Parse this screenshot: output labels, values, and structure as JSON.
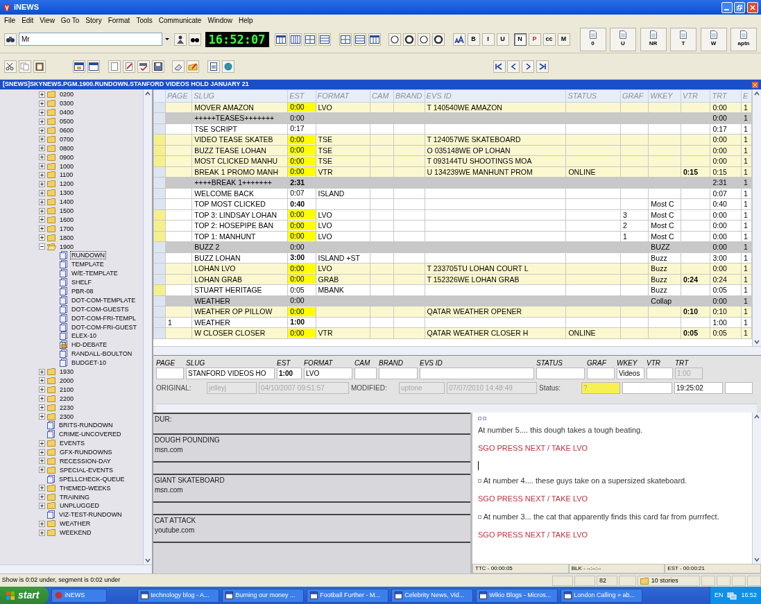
{
  "window": {
    "title": "iNEWS"
  },
  "menu": [
    "File",
    "Edit",
    "View",
    "Go To",
    "Story",
    "Format",
    "Tools",
    "Communicate",
    "Window",
    "Help"
  ],
  "toolbar": {
    "search": {
      "value": "Mr"
    },
    "clock": "16:52:07",
    "format_buttons": [
      {
        "label": "B",
        "pressed": false
      },
      {
        "label": "I",
        "pressed": false
      },
      {
        "label": "U",
        "pressed": false
      },
      {
        "label": "N",
        "pressed": true
      },
      {
        "label": "P",
        "pressed": false
      },
      {
        "label": "cc",
        "pressed": false
      },
      {
        "label": "M",
        "pressed": false
      }
    ],
    "doc_buttons": [
      "0",
      "U",
      "NR",
      "T",
      "W",
      "aptn"
    ]
  },
  "story_title": "[SNEWS]SKYNEWS.PGM.1900.RUNDOWN.STANFORD VIDEOS HOLD JANUARY 21",
  "tree": [
    {
      "label": "0200",
      "kind": "folder",
      "expanded": false,
      "selected": false
    },
    {
      "label": "0300",
      "kind": "folder",
      "expanded": false,
      "selected": false
    },
    {
      "label": "0400",
      "kind": "folder",
      "expanded": false,
      "selected": false
    },
    {
      "label": "0500",
      "kind": "folder",
      "expanded": false,
      "selected": false
    },
    {
      "label": "0600",
      "kind": "folder",
      "expanded": false,
      "selected": false
    },
    {
      "label": "0700",
      "kind": "folder",
      "expanded": false,
      "selected": false
    },
    {
      "label": "0800",
      "kind": "folder",
      "expanded": false,
      "selected": false
    },
    {
      "label": "0900",
      "kind": "folder",
      "expanded": false,
      "selected": false
    },
    {
      "label": "1000",
      "kind": "folder",
      "expanded": false,
      "selected": false
    },
    {
      "label": "1100",
      "kind": "folder",
      "expanded": false,
      "selected": false
    },
    {
      "label": "1200",
      "kind": "folder",
      "expanded": false,
      "selected": false
    },
    {
      "label": "1300",
      "kind": "folder",
      "expanded": false,
      "selected": false
    },
    {
      "label": "1400",
      "kind": "folder",
      "expanded": false,
      "selected": false
    },
    {
      "label": "1500",
      "kind": "folder",
      "expanded": false,
      "selected": false
    },
    {
      "label": "1600",
      "kind": "folder",
      "expanded": false,
      "selected": false
    },
    {
      "label": "1700",
      "kind": "folder",
      "expanded": false,
      "selected": false
    },
    {
      "label": "1800",
      "kind": "folder",
      "expanded": false,
      "selected": false
    },
    {
      "label": "1900",
      "kind": "folder",
      "expanded": true,
      "selected": false,
      "children": [
        {
          "label": "RUNDOWN",
          "kind": "queue",
          "locked": false,
          "selected": true
        },
        {
          "label": "TEMPLATE",
          "kind": "queue",
          "locked": false,
          "selected": false
        },
        {
          "label": "W/E-TEMPLATE",
          "kind": "queue",
          "locked": false,
          "selected": false
        },
        {
          "label": "SHELF",
          "kind": "queue",
          "locked": false,
          "selected": false
        },
        {
          "label": "PBR-08",
          "kind": "queue",
          "locked": false,
          "selected": false
        },
        {
          "label": "DOT-COM-TEMPLATE",
          "kind": "queue",
          "locked": false,
          "selected": false
        },
        {
          "label": "DOT-COM-GUESTS",
          "kind": "queue",
          "locked": false,
          "selected": false
        },
        {
          "label": "DOT-COM-FRI-TEMPL",
          "kind": "queue",
          "locked": false,
          "selected": false
        },
        {
          "label": "DOT-COM-FRI-GUEST",
          "kind": "queue",
          "locked": false,
          "selected": false
        },
        {
          "label": "ELEX-10",
          "kind": "queue",
          "locked": false,
          "selected": false
        },
        {
          "label": "HD-DEBATE",
          "kind": "queue",
          "locked": true,
          "selected": false
        },
        {
          "label": "RANDALL-BOULTON",
          "kind": "queue",
          "locked": false,
          "selected": false
        },
        {
          "label": "BUDGET-10",
          "kind": "queue",
          "locked": false,
          "selected": false
        }
      ]
    },
    {
      "label": "1930",
      "kind": "folder",
      "expanded": false,
      "selected": false
    },
    {
      "label": "2000",
      "kind": "folder",
      "expanded": false,
      "selected": false
    },
    {
      "label": "2100",
      "kind": "folder",
      "expanded": false,
      "selected": false
    },
    {
      "label": "2200",
      "kind": "folder",
      "expanded": false,
      "selected": false
    },
    {
      "label": "2230",
      "kind": "folder",
      "expanded": false,
      "selected": false
    },
    {
      "label": "2300",
      "kind": "folder",
      "expanded": false,
      "selected": false
    },
    {
      "label": "BRITS-RUNDOWN",
      "kind": "queue",
      "locked": false,
      "selected": false
    },
    {
      "label": "CRIME-UNCOVERED",
      "kind": "queue",
      "locked": false,
      "selected": false
    },
    {
      "label": "EVENTS",
      "kind": "folder",
      "expanded": false,
      "selected": false
    },
    {
      "label": "GFX-RUNDOWNS",
      "kind": "folder",
      "expanded": false,
      "selected": false
    },
    {
      "label": "RECESSION-DAY",
      "kind": "folder",
      "expanded": false,
      "selected": false
    },
    {
      "label": "SPECIAL-EVENTS",
      "kind": "folder",
      "expanded": false,
      "selected": false
    },
    {
      "label": "SPELLCHECK-QUEUE",
      "kind": "queue",
      "locked": false,
      "selected": false
    },
    {
      "label": "THEMED-WEEKS",
      "kind": "folder",
      "expanded": false,
      "selected": false
    },
    {
      "label": "TRAINING",
      "kind": "folder",
      "expanded": false,
      "selected": false
    },
    {
      "label": "UNPLUGGED",
      "kind": "folder",
      "expanded": false,
      "selected": false
    },
    {
      "label": "VIZ-TEST-RUNDOWN",
      "kind": "queue",
      "locked": false,
      "selected": false
    },
    {
      "label": "WEATHER",
      "kind": "folder",
      "expanded": false,
      "selected": false
    },
    {
      "label": "WEEKEND",
      "kind": "folder",
      "expanded": false,
      "selected": false
    }
  ],
  "rundown": {
    "columns": [
      "PAGE",
      "SLUG",
      "EST",
      "FORMAT",
      "CAM",
      "BRAND",
      "EVS ID",
      "STATUS",
      "GRAF",
      "WKEY",
      "VTR",
      "TRT",
      "E"
    ],
    "rows": [
      {
        "kind": "story",
        "marked": false,
        "slug": "MOVER AMAZON",
        "est": "0:00",
        "est_flag": true,
        "est_bold": false,
        "format": "LVO",
        "evs_id": "T 140540WE AMAZON",
        "trt": "0:00",
        "col_e": "1"
      },
      {
        "kind": "break",
        "marked": false,
        "slug": "+++++TEASES+++++++",
        "est": "0:00",
        "est_flag": false,
        "est_bold": false,
        "trt": "0:00",
        "col_e": "1"
      },
      {
        "kind": "plain",
        "marked": false,
        "slug": "TSE SCRIPT",
        "est": "0:17",
        "est_flag": false,
        "est_bold": false,
        "trt": "0:17",
        "col_e": "1"
      },
      {
        "kind": "story",
        "marked": true,
        "slug": "VIDEO TEASE SKATEB",
        "est": "0:00",
        "est_flag": true,
        "est_bold": false,
        "format": "TSE",
        "evs_id": "T 124057WE SKATEBOARD",
        "trt": "0:00",
        "col_e": "1"
      },
      {
        "kind": "story",
        "marked": true,
        "slug": "BUZZ TEASE LOHAN",
        "est": "0:00",
        "est_flag": true,
        "est_bold": false,
        "format": "TSE",
        "evs_id": "O 035148WE OP LOHAN",
        "trt": "0:00",
        "col_e": "1"
      },
      {
        "kind": "story",
        "marked": true,
        "slug": "MOST CLICKED MANHU",
        "est": "0:00",
        "est_flag": true,
        "est_bold": false,
        "format": "TSE",
        "evs_id": "T 093144TU SHOOTINGS MOA",
        "trt": "0:00",
        "col_e": "1"
      },
      {
        "kind": "story",
        "marked": false,
        "slug": "BREAK 1 PROMO MANH",
        "est": "0:00",
        "est_flag": true,
        "est_bold": false,
        "format": "VTR",
        "evs_id": "U 134239WE MANHUNT PROM",
        "status": "ONLINE",
        "vtr": "0:15",
        "trt": "0:15",
        "col_e": "1"
      },
      {
        "kind": "break",
        "marked": false,
        "slug": "++++BREAK 1+++++++",
        "est": "2:31",
        "est_flag": false,
        "est_bold": true,
        "trt": "2:31",
        "col_e": "1"
      },
      {
        "kind": "plain",
        "marked": false,
        "slug": "WELCOME BACK",
        "est": "0:07",
        "est_flag": false,
        "est_bold": false,
        "format": "ISLAND",
        "trt": "0:07",
        "col_e": "1"
      },
      {
        "kind": "plain",
        "marked": false,
        "slug": "TOP MOST CLICKED",
        "est": "0:40",
        "est_flag": false,
        "est_bold": true,
        "wkey": "Most C",
        "trt": "0:40",
        "col_e": "1"
      },
      {
        "kind": "plain",
        "marked": true,
        "slug": "TOP 3: LINDSAY LOHAN",
        "est": "0:00",
        "est_flag": true,
        "est_bold": false,
        "format": "LVO",
        "graf": "3",
        "wkey": "Most C",
        "trt": "0:00",
        "col_e": "1"
      },
      {
        "kind": "plain",
        "marked": true,
        "slug": "TOP 2: HOSEPIPE BAN",
        "est": "0:00",
        "est_flag": true,
        "est_bold": false,
        "format": "LVO",
        "graf": "2",
        "wkey": "Most C",
        "trt": "0:00",
        "col_e": "1"
      },
      {
        "kind": "plain",
        "marked": true,
        "slug": "TOP 1: MANHUNT",
        "est": "0:00",
        "est_flag": true,
        "est_bold": false,
        "format": "LVO",
        "graf": "1",
        "wkey": "Most C",
        "trt": "0:00",
        "col_e": "1"
      },
      {
        "kind": "break",
        "marked": false,
        "slug": "BUZZ 2",
        "est": "0:00",
        "est_flag": false,
        "est_bold": false,
        "wkey": "BUZZ",
        "trt": "0:00",
        "col_e": "1"
      },
      {
        "kind": "plain",
        "marked": false,
        "slug": "BUZZ LOHAN",
        "est": "3:00",
        "est_flag": false,
        "est_bold": true,
        "format": "ISLAND +ST",
        "wkey": "Buzz",
        "trt": "3:00",
        "col_e": "1"
      },
      {
        "kind": "story",
        "marked": false,
        "slug": "LOHAN LVO",
        "est": "0:00",
        "est_flag": true,
        "est_bold": false,
        "format": "LVO",
        "evs_id": "T 233705TU LOHAN COURT L",
        "wkey": "Buzz",
        "trt": "0:00",
        "col_e": "1"
      },
      {
        "kind": "story",
        "marked": false,
        "slug": "LOHAN GRAB",
        "est": "0:00",
        "est_flag": true,
        "est_bold": false,
        "format": "GRAB",
        "evs_id": "T 152326WE LOHAN GRAB",
        "wkey": "Buzz",
        "vtr": "0:24",
        "trt": "0:24",
        "col_e": "1"
      },
      {
        "kind": "plain",
        "marked": true,
        "slug": "STUART HERITAGE",
        "est": "0:05",
        "est_flag": false,
        "est_bold": false,
        "format": "MBANK",
        "wkey": "Buzz",
        "trt": "0:05",
        "col_e": "1"
      },
      {
        "kind": "break",
        "marked": false,
        "slug": "WEATHER",
        "est": "0:00",
        "est_flag": false,
        "est_bold": false,
        "wkey": "Collap",
        "trt": "0:00",
        "col_e": "1"
      },
      {
        "kind": "story",
        "marked": false,
        "slug": "WEATHER OP PILLOW",
        "est": "0:00",
        "est_flag": true,
        "est_bold": false,
        "evs_id": "QATAR WEATHER OPENER",
        "vtr": "0:10",
        "trt": "0:10",
        "col_e": "1"
      },
      {
        "kind": "plain",
        "marked": false,
        "page": "1",
        "slug": "WEATHER",
        "est": "1:00",
        "est_flag": false,
        "est_bold": true,
        "trt": "1:00",
        "col_e": "1"
      },
      {
        "kind": "story",
        "marked": false,
        "slug": "W CLOSER CLOSER",
        "est": "0:00",
        "est_flag": true,
        "est_bold": false,
        "format": "VTR",
        "evs_id": "QATAR WEATHER CLOSER H",
        "status": "ONLINE",
        "vtr": "0:05",
        "trt": "0:05",
        "col_e": "1"
      }
    ]
  },
  "detail": {
    "fields": [
      {
        "label": "PAGE",
        "disabled": false
      },
      {
        "label": "SLUG",
        "value": "STANFORD VIDEOS HO",
        "disabled": false,
        "bold": false
      },
      {
        "label": "EST",
        "value": "1:00",
        "disabled": false,
        "bold": true
      },
      {
        "label": "FORMAT",
        "value": "LVO",
        "disabled": false,
        "bold": false
      },
      {
        "label": "CAM",
        "disabled": false
      },
      {
        "label": "BRAND",
        "disabled": false
      },
      {
        "label": "EVS ID",
        "disabled": false
      },
      {
        "label": "STATUS",
        "disabled": false
      },
      {
        "label": "GRAF",
        "disabled": false
      },
      {
        "label": "WKEY",
        "value": "Videos",
        "disabled": false,
        "bold": false
      },
      {
        "label": "VTR",
        "disabled": false
      },
      {
        "label": "TRT",
        "value": "1:00",
        "disabled": true,
        "bold": false
      }
    ],
    "info": [
      {
        "kind": "label",
        "text": "ORIGINAL:"
      },
      {
        "kind": "field",
        "value": "jelleyj",
        "disabled": true,
        "highlight": false
      },
      {
        "kind": "field",
        "value": "04/10/2007 09:51:57",
        "disabled": true,
        "highlight": false
      },
      {
        "kind": "label",
        "text": "MODIFIED:"
      },
      {
        "kind": "field",
        "value": "uptone",
        "disabled": true,
        "highlight": false
      },
      {
        "kind": "field",
        "value": "07/07/2010 14:48:49",
        "disabled": true,
        "highlight": false
      },
      {
        "kind": "label",
        "text": "Status:"
      },
      {
        "kind": "field",
        "value": "?",
        "disabled": true,
        "highlight": true
      },
      {
        "kind": "field",
        "disabled": false,
        "highlight": false
      },
      {
        "kind": "field",
        "value": "19:25:02",
        "disabled": false,
        "highlight": false
      },
      {
        "kind": "field",
        "disabled": false,
        "highlight": false
      }
    ]
  },
  "notes": [
    {
      "kind": "header",
      "title": "DUR:"
    },
    {
      "kind": "item",
      "title": "DOUGH POUNDING",
      "source": "msn.com"
    },
    {
      "kind": "spacer"
    },
    {
      "kind": "item",
      "title": "GIANT SKATEBOARD",
      "source": "msn.com"
    },
    {
      "kind": "spacer"
    },
    {
      "kind": "item",
      "title": "CAT ATTACK",
      "source": "youtube.com"
    },
    {
      "kind": "spacer"
    }
  ],
  "script": {
    "paragraphs": [
      {
        "kind": "text",
        "bullet": false,
        "text": "At number 5.... this dough takes a tough beating."
      },
      {
        "kind": "cue",
        "text": "SGO PRESS NEXT / TAKE LVO"
      },
      {
        "kind": "cursor"
      },
      {
        "kind": "text",
        "bullet": true,
        "text": "At number 4.... these guys take on a supersized skateboard."
      },
      {
        "kind": "cue",
        "text": "SGO PRESS NEXT / TAKE LVO"
      },
      {
        "kind": "text",
        "bullet": true,
        "text": "At number 3... the cat that apparently finds this card far from purrrfect."
      },
      {
        "kind": "cue",
        "text": "SGO PRESS NEXT / TAKE LVO"
      }
    ],
    "footer": [
      "TTC - 00:00:05",
      "BLK - --:--:--",
      "EST - 00:00:21"
    ]
  },
  "status_bar": {
    "message": "Show is 0:02 under, segment is 0:02 under",
    "count": "82",
    "stories": "10 stories"
  },
  "taskbar": {
    "start": "start",
    "tasks": [
      {
        "label": "iNEWS",
        "selected": false
      },
      {
        "label": "technology blog - A...",
        "selected": false
      },
      {
        "label": "Burning our money ...",
        "selected": false
      },
      {
        "label": "Football Further - M...",
        "selected": false
      },
      {
        "label": "Celebrity News, Vid...",
        "selected": false
      },
      {
        "label": "Wikio Blogs - Micros...",
        "selected": false
      },
      {
        "label": "London Calling » ab...",
        "selected": false
      }
    ],
    "language": "EN",
    "clock": "16:52"
  }
}
